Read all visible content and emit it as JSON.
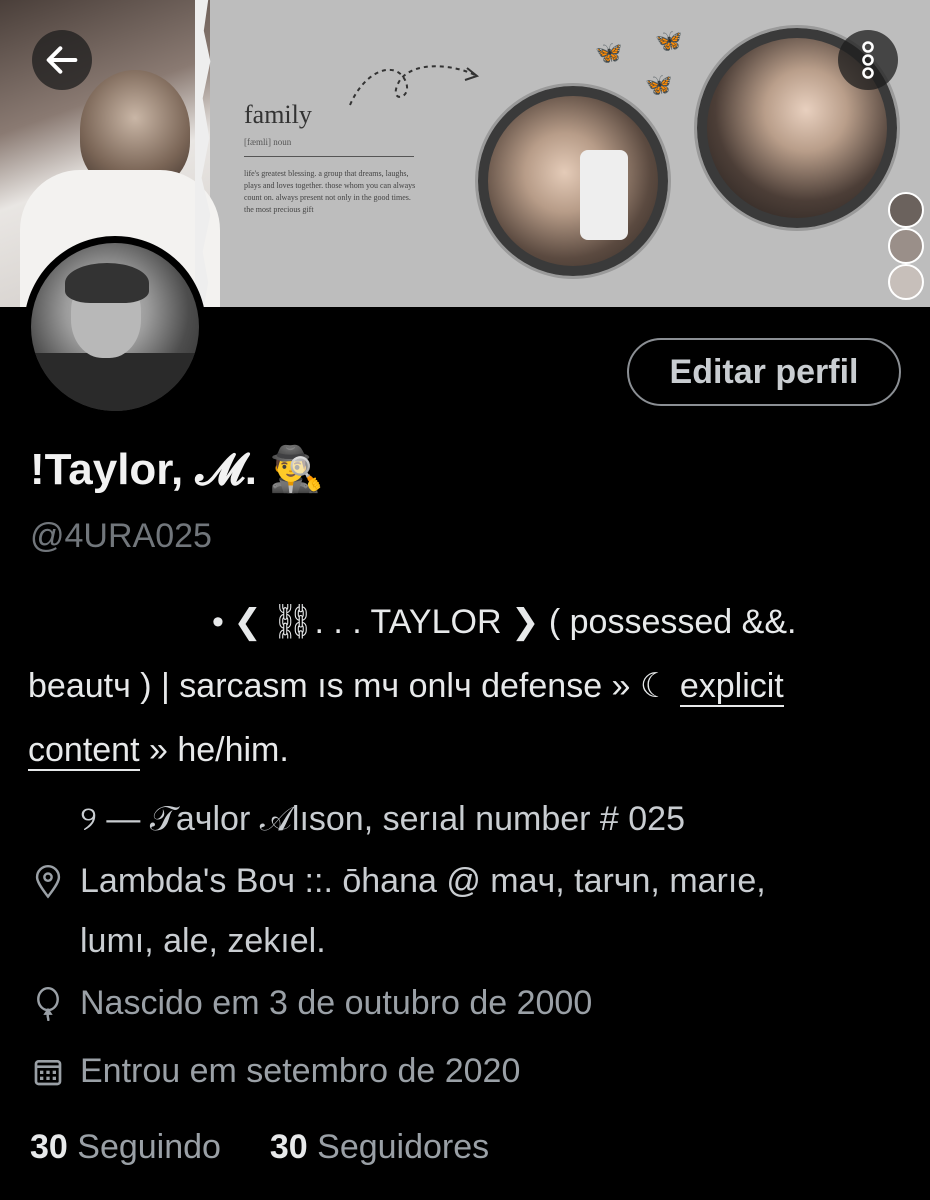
{
  "header": {
    "banner_word": "family",
    "banner_phonetic": "[fæmli] noun",
    "banner_definition": "life's greatest blessing. a group that dreams, laughs, plays and loves together. those whom you can always count on. always present not only in the good times. the most precious gift"
  },
  "profile": {
    "display_name": "!Taylor, 𝓜. 🕵️‍♂️",
    "handle": "@4URA025",
    "edit_button": "Editar perfil"
  },
  "bio": {
    "line1": "• ❮ ⛓. . . TAYLOR ❯ ( possessed &&.",
    "line2_prefix": "beautч ) | sarcasm ıs mч onlч defense » ☾ ",
    "line2_link": "explicit",
    "line3_link": "content",
    "line3_suffix": " » he/him."
  },
  "info": {
    "name_line": "୨ —  𝒯aчlor 𝒜lıson, serıal number # 025",
    "location_line1": "Lambda's Boч ::. ōhana @ maч, tarчn, marıe,",
    "location_line2": "lumı, ale, zekıel.",
    "birthday": "Nascido em 3 de outubro de 2000",
    "joined": "Entrou em setembro de 2020"
  },
  "stats": {
    "following_count": "30",
    "following_label": "Seguindo",
    "followers_count": "30",
    "followers_label": "Seguidores"
  },
  "icons": {
    "back": "arrow-left-icon",
    "more": "more-vertical-icon",
    "location": "location-pin-icon",
    "birthday": "balloon-icon",
    "calendar": "calendar-icon"
  },
  "colors": {
    "background": "#000000",
    "text_primary": "#e7e9ea",
    "text_secondary": "#71767b",
    "banner_bg": "#bdbdbd"
  }
}
